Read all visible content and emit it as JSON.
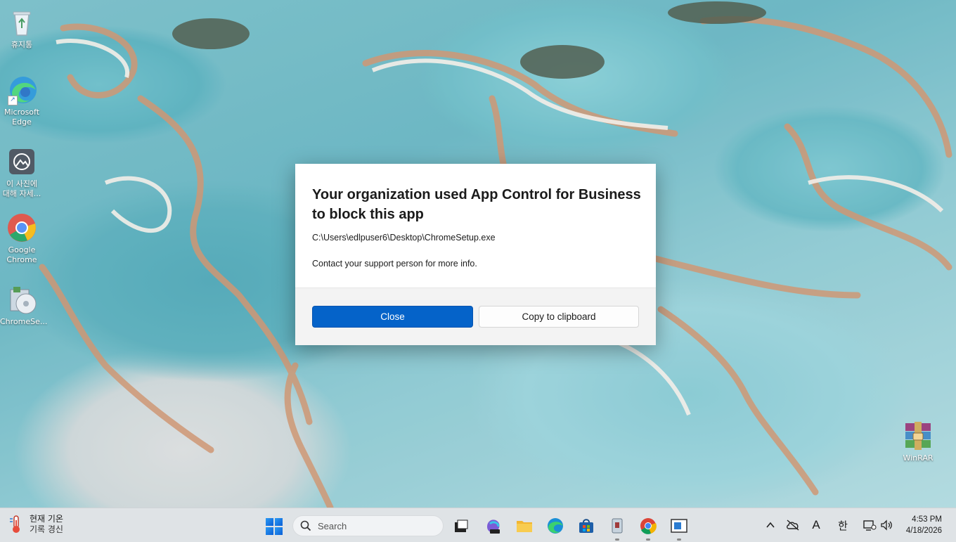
{
  "desktop": {
    "icons": [
      {
        "name": "recycle-bin",
        "label": "휴지통"
      },
      {
        "name": "microsoft-edge",
        "label": "Microsoft\nEdge"
      },
      {
        "name": "photo-info",
        "label": "이 사진에\n대해 자세..."
      },
      {
        "name": "google-chrome",
        "label": "Google\nChrome"
      },
      {
        "name": "chrome-setup",
        "label": "ChromeSe..."
      },
      {
        "name": "winrar",
        "label": "WinRAR"
      }
    ]
  },
  "dialog": {
    "title": "Your organization used App Control for Business to block this app",
    "path": "C:\\Users\\edlpuser6\\Desktop\\ChromeSetup.exe",
    "info": "Contact your support person for more info.",
    "close_label": "Close",
    "copy_label": "Copy to clipboard",
    "accent_color": "#0563c9"
  },
  "taskbar": {
    "weather_line1": "현재 기온",
    "weather_line2": "기록 경신",
    "search_placeholder": "Search",
    "pinned": [
      "task-view",
      "m365-copilot",
      "file-explorer",
      "edge",
      "microsoft-store",
      "chrome-setup",
      "chrome",
      "remote-desktop"
    ],
    "tray": {
      "ime_letter": "A",
      "lang": "한"
    },
    "clock": {
      "time": "4:53 PM",
      "date": "4/18/2026"
    }
  }
}
